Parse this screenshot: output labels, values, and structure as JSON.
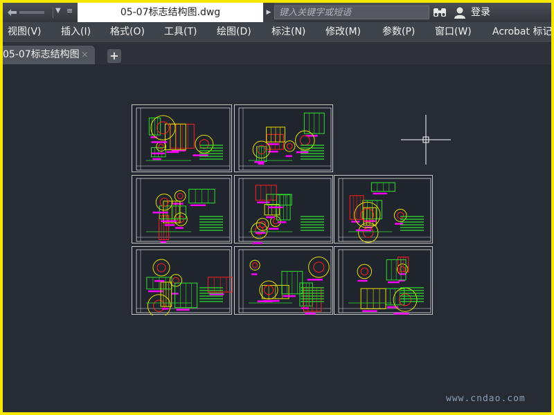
{
  "window": {
    "document_title": "05-07标志结构图.dwg",
    "search_placeholder": "键入关键字或短语",
    "login_label": "登录"
  },
  "menu": [
    "视图(V)",
    "插入(I)",
    "格式(O)",
    "工具(T)",
    "绘图(D)",
    "标注(N)",
    "修改(M)",
    "参数(P)",
    "窗口(W)",
    "Acrobat 标记"
  ],
  "tabs": [
    {
      "label": "05-07标志结构图",
      "close": "×"
    }
  ],
  "new_tab_label": "+",
  "watermark": "www.cndao.com",
  "colors": {
    "canvas": "#262b34",
    "line_green": "#2fe02f",
    "line_red": "#ff2020",
    "line_magenta": "#ff00ff",
    "line_yellow": "#e8e000",
    "line_white": "#dcdcdc",
    "frame_yellow": "#f7e700"
  },
  "icons": {
    "undo": "undo-icon",
    "dropdown": "chevron-down-icon",
    "search_arrow": "triangle-right-icon",
    "binoculars": "binoculars-icon",
    "user": "user-icon",
    "close": "close-icon",
    "add": "plus-icon",
    "crosshair": "crosshair-cursor-icon"
  }
}
